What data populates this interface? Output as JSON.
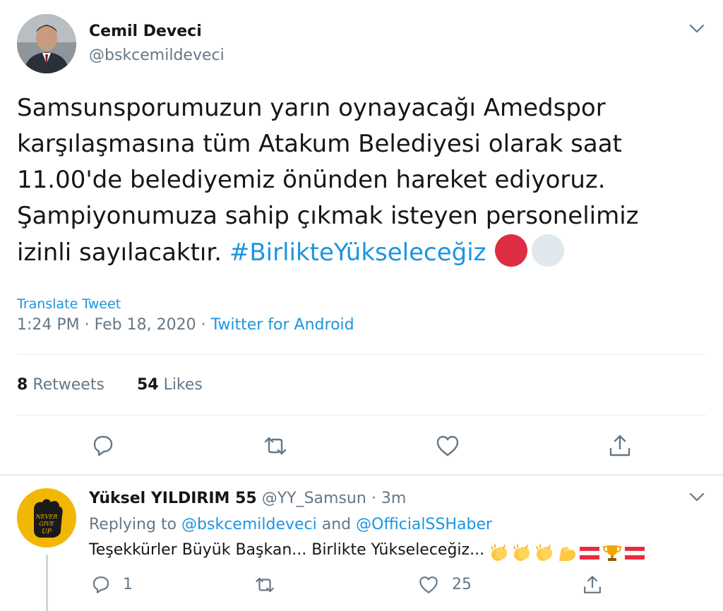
{
  "main_tweet": {
    "author_name": "Cemil Deveci",
    "author_handle": "@bskcemildeveci",
    "text_lines": [
      "Samsunsporumuzun yarın oynayacağı Amedspor",
      "karşılaşmasına tüm Atakum Belediyesi olarak saat",
      "11.00'de belediyemiz önünden hareket ediyoruz.",
      "Şampiyonumuza sahip çıkmak isteyen personelimiz",
      "izinli sayılacaktır."
    ],
    "hashtag": "#BirlikteYükseleceğiz",
    "emoji": [
      "red-circle",
      "white-circle"
    ],
    "translate_label": "Translate Tweet",
    "time": "1:24 PM",
    "date": "Feb 18, 2020",
    "separator": "·",
    "source": "Twitter for Android",
    "retweets_count": "8",
    "retweets_label": "Retweets",
    "likes_count": "54",
    "likes_label": "Likes",
    "actions": [
      "reply-icon",
      "retweet-icon",
      "like-icon",
      "share-icon"
    ]
  },
  "reply_tweet": {
    "author_name": "Yüksel YILDIRIM 55",
    "author_handle": "@YY_Samsun",
    "separator": "·",
    "time_ago": "3m",
    "replying_to_label": "Replying to",
    "replying_user_1": "@bskcemildeveci",
    "replying_and": "and",
    "replying_user_2": "@OfficialSSHaber",
    "text": "Teşekkürler Büyük Başkan... Birlikte Yükseleceğiz...",
    "emoji": [
      "clapping-hands",
      "clapping-hands",
      "clapping-hands",
      "flexed-biceps",
      "austrian-flag",
      "trophy",
      "austrian-flag"
    ],
    "avatar_text": [
      "NEVER",
      "GIVE",
      "UP"
    ],
    "reply_count": "1",
    "like_count": "25"
  },
  "colors": {
    "link": "#1b95e0",
    "secondary_text": "#657786",
    "primary_text": "#14171a",
    "divider": "#e6ecf0",
    "hashtag_circle_red": "#dd2e44"
  }
}
